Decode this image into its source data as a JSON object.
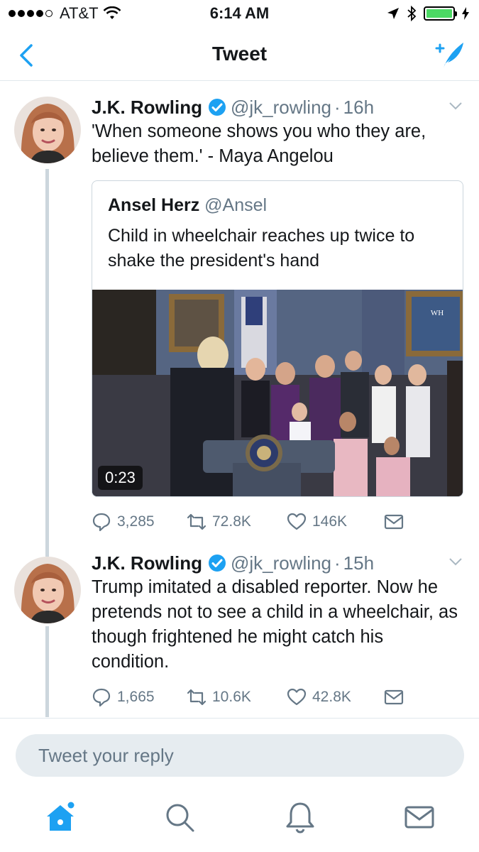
{
  "status_bar": {
    "carrier": "AT&T",
    "time": "6:14 AM",
    "battery_level": 1.0,
    "signal_bars": 4
  },
  "nav": {
    "title": "Tweet",
    "back_icon": "chevron-left-icon",
    "compose_icon": "compose-tweet-icon"
  },
  "tweets": [
    {
      "name": "J.K. Rowling",
      "handle": "@jk_rowling",
      "separator": "·",
      "time": "16h",
      "text": "'When someone shows you who they are, believe them.' - Maya Angelou",
      "quote": {
        "name": "Ansel Herz",
        "handle": "@Ansel",
        "text": "Child in wheelchair reaches up twice to shake the president's hand",
        "video_duration": "0:23"
      },
      "replies": "3,285",
      "retweets": "72.8K",
      "likes": "146K"
    },
    {
      "name": "J.K. Rowling",
      "handle": "@jk_rowling",
      "separator": "·",
      "time": "15h",
      "text": "Trump imitated a disabled reporter. Now he pretends not to see a child in a wheelchair, as though frightened he might catch his condition.",
      "replies": "1,665",
      "retweets": "10.6K",
      "likes": "42.8K"
    }
  ],
  "reply": {
    "placeholder": "Tweet your reply"
  },
  "colors": {
    "accent": "#1da1f2",
    "secondary_text": "#657786",
    "battery": "#4cd964"
  }
}
